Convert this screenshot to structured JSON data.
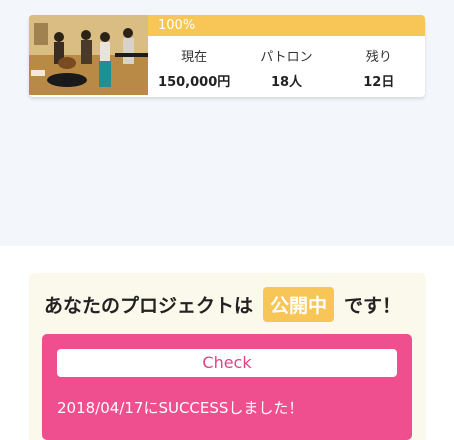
{
  "project": {
    "progress_label": "100%",
    "progress": 1.0,
    "stats": [
      {
        "label": "現在",
        "value": "150,000円"
      },
      {
        "label": "パトロン",
        "value": "18人"
      },
      {
        "label": "残り",
        "value": "12日"
      }
    ]
  },
  "status": {
    "prefix": "あなたのプロジェクトは",
    "badge": "公開中",
    "suffix": "です！",
    "check_button": "Check",
    "success_message": "2018/04/17にSUCCESSしました！"
  },
  "colors": {
    "accent_yellow": "#f7c657",
    "accent_pink": "#ef4e8f"
  }
}
